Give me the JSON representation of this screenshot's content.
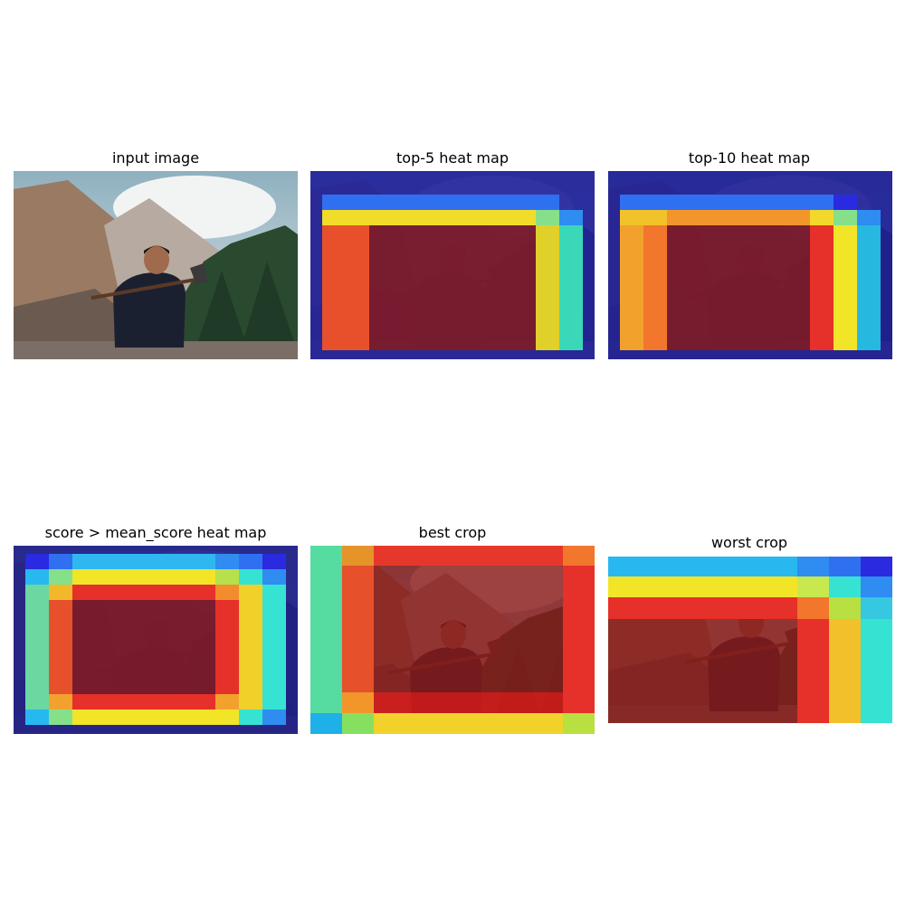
{
  "panels": [
    {
      "title": "input image"
    },
    {
      "title": "top-5 heat map"
    },
    {
      "title": "top-10 heat map"
    },
    {
      "title": "score > mean_score heat map"
    },
    {
      "title": "best crop"
    },
    {
      "title": "worst crop"
    }
  ],
  "colors": {
    "dark_blue": "#1e1e96",
    "blue": "#2f6ff0",
    "sky": "#27b8f0",
    "cyan": "#36e3d2",
    "green": "#86e08a",
    "yellow": "#f2e528",
    "orange": "#f28c2c",
    "red": "#e6332a",
    "dark_red": "#8c1e1e"
  }
}
